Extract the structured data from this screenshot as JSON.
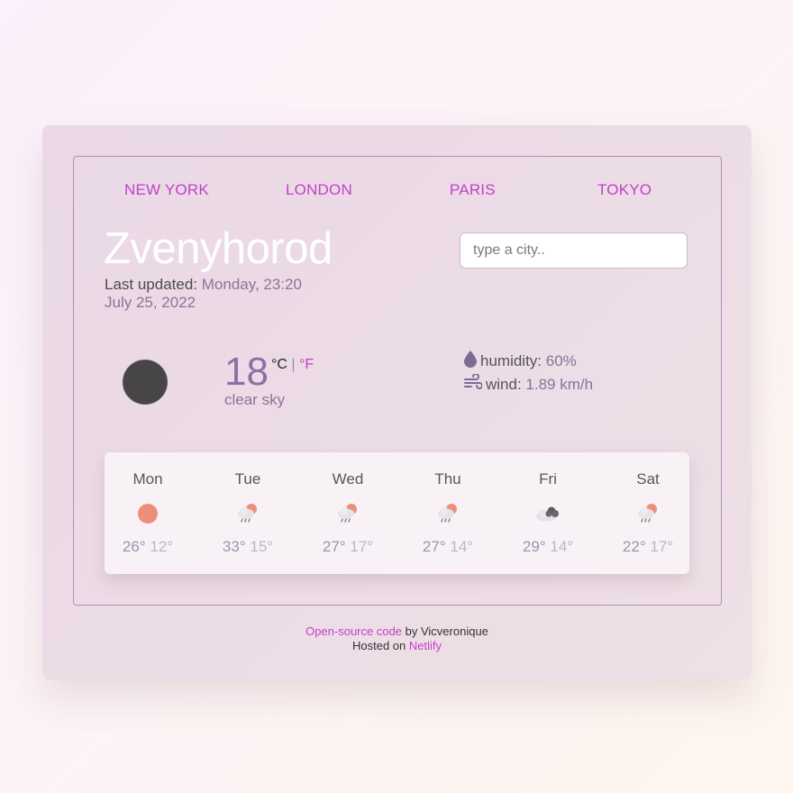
{
  "nav": {
    "cities": [
      "NEW YORK",
      "LONDON",
      "PARIS",
      "TOKYO"
    ]
  },
  "current": {
    "city": "Zvenyhorod",
    "updated_label": "Last updated:",
    "updated_time": "Monday, 23:20",
    "date": "July 25, 2022",
    "temperature": "18",
    "unit_c": "°C",
    "unit_sep": "|",
    "unit_f": "°F",
    "description": "clear sky",
    "icon": "dark-circle-icon",
    "humidity_label": "humidity:",
    "humidity_value": "60%",
    "wind_label": "wind:",
    "wind_value": "1.89 km/h"
  },
  "search": {
    "placeholder": "type a city.."
  },
  "forecast": [
    {
      "day": "Mon",
      "max": "26°",
      "min": "12°",
      "icon": "sun-icon"
    },
    {
      "day": "Tue",
      "max": "33°",
      "min": "15°",
      "icon": "rain-sun-icon"
    },
    {
      "day": "Wed",
      "max": "27°",
      "min": "17°",
      "icon": "rain-sun-icon"
    },
    {
      "day": "Thu",
      "max": "27°",
      "min": "14°",
      "icon": "rain-sun-icon"
    },
    {
      "day": "Fri",
      "max": "29°",
      "min": "14°",
      "icon": "cloud-icon"
    },
    {
      "day": "Sat",
      "max": "22°",
      "min": "17°",
      "icon": "rain-sun-icon"
    }
  ],
  "footer": {
    "code_link": "Open-source code",
    "by_text": " by Vicveronique",
    "hosted_text": "Hosted on ",
    "host_link": "Netlify"
  },
  "colors": {
    "accent": "#c33fc9",
    "muted": "#8b7399",
    "title": "#ffffff"
  }
}
